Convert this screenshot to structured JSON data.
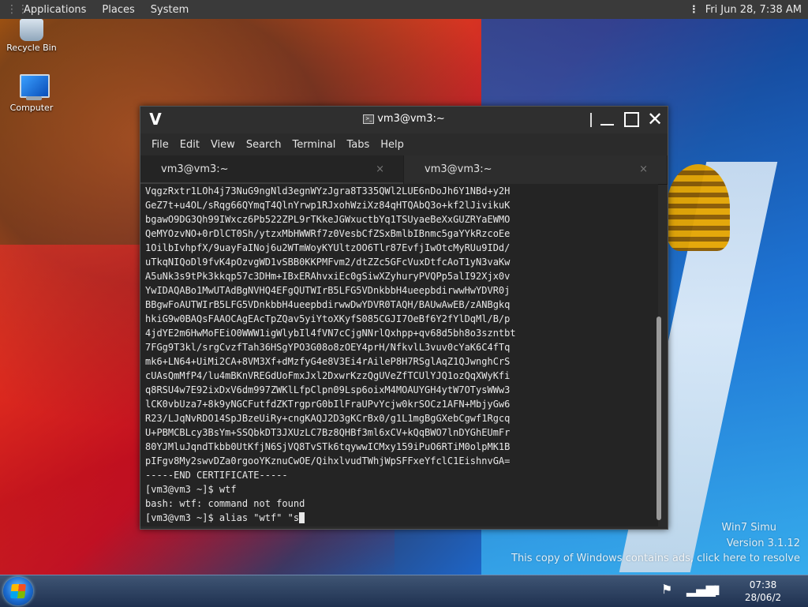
{
  "top_panel": {
    "menus": [
      "Applications",
      "Places",
      "System"
    ],
    "clock": "Fri Jun 28,  7:38 AM"
  },
  "desktop": {
    "icons": [
      {
        "label": "Recycle Bin"
      },
      {
        "label": "Computer"
      }
    ]
  },
  "terminal": {
    "title": "vm3@vm3:~",
    "menu": [
      "File",
      "Edit",
      "View",
      "Search",
      "Terminal",
      "Tabs",
      "Help"
    ],
    "tabs": [
      {
        "label": "vm3@vm3:~",
        "close": "×"
      },
      {
        "label": "vm3@vm3:~",
        "close": "×"
      }
    ],
    "lines": [
      "VqgzRxtr1LOh4j73NuG9ngNld3egnWYzJgra8T335QWl2LUE6nDoJh6Y1NBd+y2H",
      "GeZ7t+u4OL/sRqg66QYmqT4QlnYrwp1RJxohWziXz84qHTQAbQ3o+kf2lJivikuK",
      "bgawO9DG3Qh99IWxcz6Pb522ZPL9rTKkeJGWxuctbYq1TSUyaeBeXxGUZRYaEWMO",
      "QeMYOzvNO+0rDlCT0Sh/ytzxMbHWWRf7z0VesbCfZSxBmlbIBnmc5gaYYkRzcoEe",
      "1OilbIvhpfX/9uayFaINoj6u2WTmWoyKYUltzOO6Tlr87EvfjIwOtcMyRUu9IDd/",
      "uTkqNIQoDl9fvK4pOzvgWD1vSBB0KKPMFvm2/dtZZc5GFcVuxDtfcAoT1yN3vaKw",
      "A5uNk3s9tPk3kkqp57c3DHm+IBxERAhvxiEc0gSiwXZyhuryPVQPp5alI92Xjx0v",
      "YwIDAQABo1MwUTAdBgNVHQ4EFgQUTWIrB5LFG5VDnkbbH4ueepbdirwwHwYDVR0j",
      "BBgwFoAUTWIrB5LFG5VDnkbbH4ueepbdirwwDwYDVR0TAQH/BAUwAwEB/zANBgkq",
      "hkiG9w0BAQsFAAOCAgEAcTpZQav5yiYtoXKyfS085CGJI7OeBf6Y2fYlDqMl/B/p",
      "4jdYE2m6HwMoFEiO0WWW1igWlybIl4fVN7cCjgNNrlQxhpp+qv68d5bh8o3szntbt",
      "7FGg9T3kl/srgCvzfTah36HSgYPO3G08o8zOEY4prH/NfkvlL3vuv0cYaK6C4fTq",
      "mk6+LN64+UiMi2CA+8VM3Xf+dMzfyG4e8V3Ei4rAileP8H7RSglAqZ1QJwnghCrS",
      "cUAsQmMfP4/lu4mBKnVREGdUoFmxJxl2DxwrKzzQgUVeZfTCUlYJQ1ozQqXWyKfi",
      "q8RSU4w7E92ixDxV6dm997ZWKlLfpClpn09Lsp6oixM4MOAUYGH4ytW7OTysWWw3",
      "lCK0vbUza7+8k9yNGCFutfdZKTrgprG0bIlFraUPvYcjw0krSOCz1AFN+MbjyGw6",
      "R23/LJqNvRDO14SpJBzeUiRy+cngKAQJ2D3gKCrBx0/g1L1mgBgGXebCgwf1Rgcq",
      "U+PBMCBLcy3BsYm+SSQbkDT3JXUzLC7Bz8QHBf3ml6xCV+kQqBWO7lnDYGhEUmFr",
      "80YJMluJqndTkbb0UtKfjN6SjVQ8TvSTk6tqywwICMxy159iPuO6RTiM0olpMK1B",
      "pIFgv8My2swvDZa0rgooYKznuCwOE/QihxlvudTWhjWpSFFxeYfclC1EishnvGA=",
      "-----END CERTIFICATE-----",
      "[vm3@vm3 ~]$ wtf",
      "bash: wtf: command not found"
    ],
    "prompt_line": "[vm3@vm3 ~]$ alias \"wtf\" \"s"
  },
  "watermark": {
    "line1": "Win7 Simu",
    "line2": "Version 3.1.12",
    "line3": "This copy of Windows contains ads, click here to resolve"
  },
  "taskbar": {
    "time": "07:38",
    "date": "28/06/2"
  }
}
